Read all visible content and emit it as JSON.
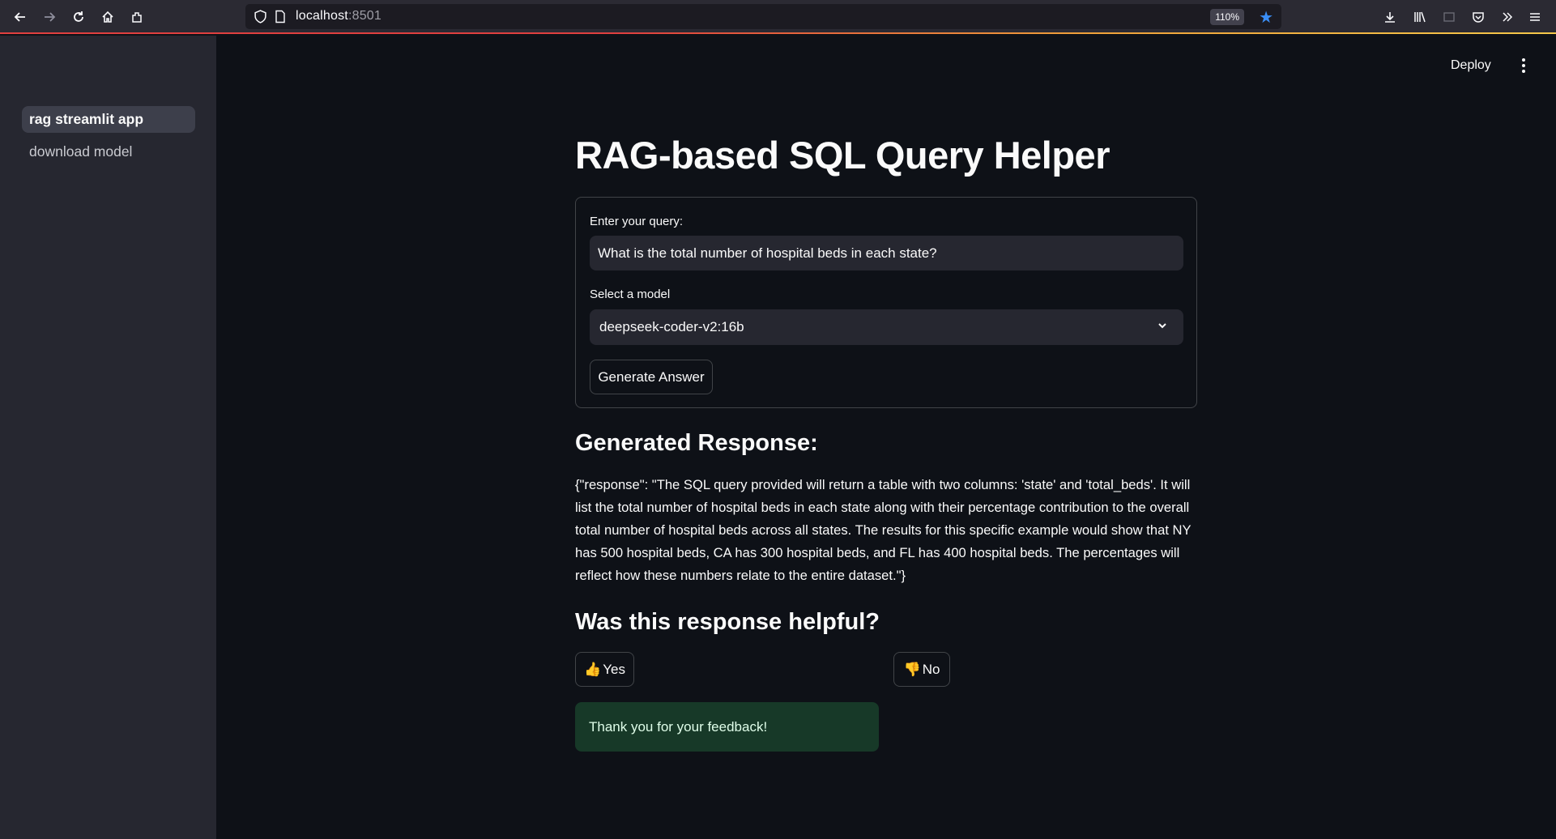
{
  "browser": {
    "url_host": "localhost",
    "url_port": ":8501",
    "zoom": "110%"
  },
  "sidebar": {
    "items": [
      {
        "label": "rag streamlit app",
        "active": true
      },
      {
        "label": "download model",
        "active": false
      }
    ]
  },
  "header": {
    "deploy_label": "Deploy"
  },
  "main": {
    "title": "RAG-based SQL Query Helper",
    "form": {
      "query_label": "Enter your query:",
      "query_value": "What is the total number of hospital beds in each state?",
      "model_label": "Select a model",
      "model_value": "deepseek-coder-v2:16b",
      "submit_label": "Generate Answer"
    },
    "response_heading": "Generated Response:",
    "response_text": "{\"response\": \"The SQL query provided will return a table with two columns: 'state' and 'total_beds'. It will list the total number of hospital beds in each state along with their percentage contribution to the overall total number of hospital beds across all states. The results for this specific example would show that NY has 500 hospital beds, CA has 300 hospital beds, and FL has 400 hospital beds. The percentages will reflect how these numbers relate to the entire dataset.\"}",
    "feedback_heading": "Was this response helpful?",
    "yes_label": "Yes",
    "no_label": "No",
    "thanks_message": "Thank you for your feedback!"
  },
  "icons": {
    "yes_emoji": "👍",
    "no_emoji": "👎"
  },
  "colors": {
    "background": "#0e1117",
    "sidebar": "#262730",
    "success_bg": "#173928",
    "star": "#3a8ef6"
  }
}
